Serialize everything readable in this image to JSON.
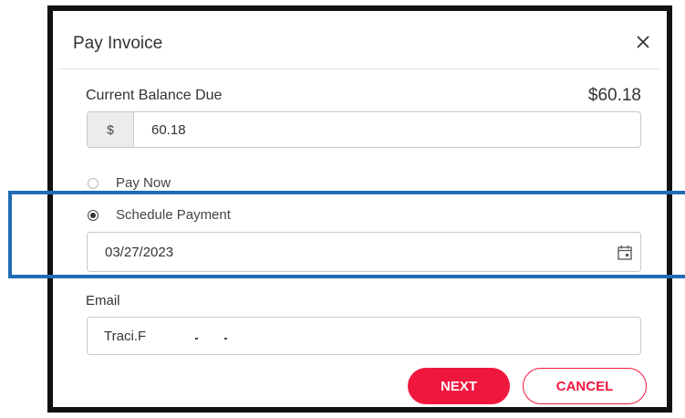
{
  "dialog": {
    "title": "Pay Invoice",
    "close_glyph": "✕"
  },
  "balance": {
    "label": "Current Balance Due",
    "amount": "$60.18",
    "currency_prefix": "$",
    "input_value": "60.18"
  },
  "payment_options": [
    {
      "label": "Pay Now",
      "selected": false
    },
    {
      "label": "Schedule Payment",
      "selected": true
    }
  ],
  "schedule": {
    "date_value": "03/27/2023",
    "icon": "calendar-icon"
  },
  "email": {
    "label": "Email",
    "value": "Traci.F"
  },
  "actions": {
    "next_label": "NEXT",
    "cancel_label": "CANCEL"
  },
  "colors": {
    "accent": "#f0173f",
    "highlight": "#1f6bb5"
  }
}
